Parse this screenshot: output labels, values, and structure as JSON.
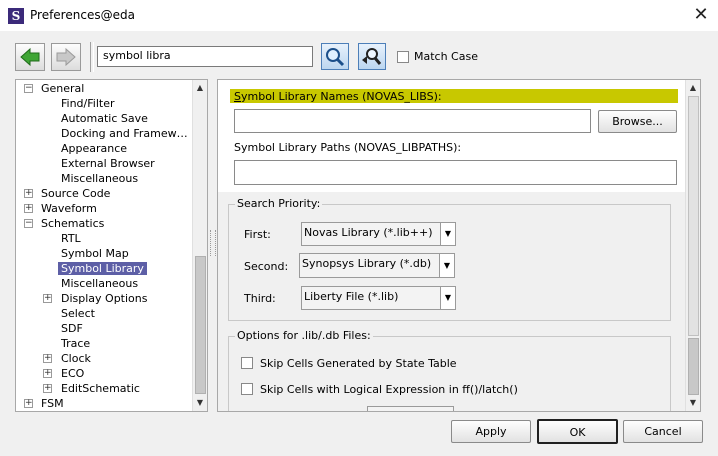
{
  "window": {
    "app_icon_letter": "S",
    "title": "Preferences@eda",
    "close_glyph": "✕"
  },
  "toolbar": {
    "search_value": "symbol libra",
    "match_case_label": "Match Case",
    "back_icon": "green-left-arrow",
    "forward_icon": "gray-right-arrow",
    "find_icon": "magnifier",
    "find_next_icon": "magnifier-with-arrow"
  },
  "tree": {
    "items": [
      {
        "label": "General",
        "expander": "−"
      },
      {
        "label": "Find/Filter"
      },
      {
        "label": "Automatic Save"
      },
      {
        "label": "Docking and Framew…"
      },
      {
        "label": "Appearance"
      },
      {
        "label": "External Browser"
      },
      {
        "label": "Miscellaneous"
      },
      {
        "label": "Source Code",
        "expander": "+"
      },
      {
        "label": "Waveform",
        "expander": "+"
      },
      {
        "label": "Schematics",
        "expander": "−"
      },
      {
        "label": "RTL"
      },
      {
        "label": "Symbol Map"
      },
      {
        "label": "Symbol Library",
        "selected": true
      },
      {
        "label": "Miscellaneous"
      },
      {
        "label": "Display Options",
        "expander": "+"
      },
      {
        "label": "Select"
      },
      {
        "label": "SDF"
      },
      {
        "label": "Trace"
      },
      {
        "label": "Clock",
        "expander": "+"
      },
      {
        "label": "ECO",
        "expander": "+"
      },
      {
        "label": "EditSchematic",
        "expander": "+"
      },
      {
        "label": "FSM",
        "expander": "+"
      }
    ]
  },
  "panel": {
    "names_label": "Symbol Library Names (NOVAS_LIBS):",
    "names_value": "",
    "browse_label": "Browse...",
    "paths_label": "Symbol Library Paths (NOVAS_LIBPATHS):",
    "paths_value": "",
    "search_priority": {
      "title": "Search Priority:",
      "first_label": "First:",
      "first_value": "Novas Library (*.lib++)",
      "second_label": "Second:",
      "second_value": "Synopsys Library (*.db)",
      "third_label": "Third:",
      "third_value": "Liberty File (*.lib)"
    },
    "options": {
      "title": "Options for .lib/.db Files:",
      "skip_state_table": "Skip Cells Generated by State Table",
      "skip_logical_expr": "Skip Cells with Logical Expression in ff()/latch()"
    },
    "highlight_color": "#c8c800"
  },
  "footer": {
    "apply_label": "Apply",
    "ok_label": "OK",
    "cancel_label": "Cancel"
  }
}
